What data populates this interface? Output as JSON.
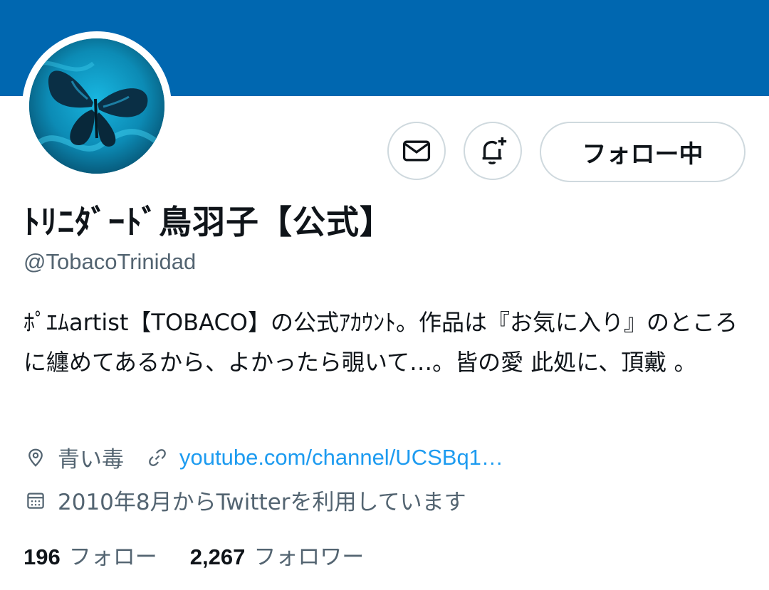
{
  "profile": {
    "display_name": "ﾄﾘﾆﾀﾞｰﾄﾞ鳥羽子【公式】",
    "handle": "@TobacoTrinidad",
    "bio": "ﾎﾟｴﾑartist【TOBACO】の公式ｱｶｳﾝﾄ。作品は『お気に入り』のところに纏めてあるから、よかったら覗いて…。皆の愛 此処に、頂戴 。",
    "location": "青い毒",
    "link": "youtube.com/channel/UCSBq1…",
    "joined": "2010年8月からTwitterを利用しています"
  },
  "actions": {
    "message_icon": "mail-icon",
    "notify_icon": "bell-plus-icon",
    "follow_label": "フォロー中"
  },
  "stats": {
    "following_count": "196",
    "following_label": "フォロー",
    "followers_count": "2,267",
    "followers_label": "フォロワー"
  },
  "colors": {
    "banner": "#0067b0",
    "link": "#1d9bf0",
    "secondary_text": "#536471"
  }
}
